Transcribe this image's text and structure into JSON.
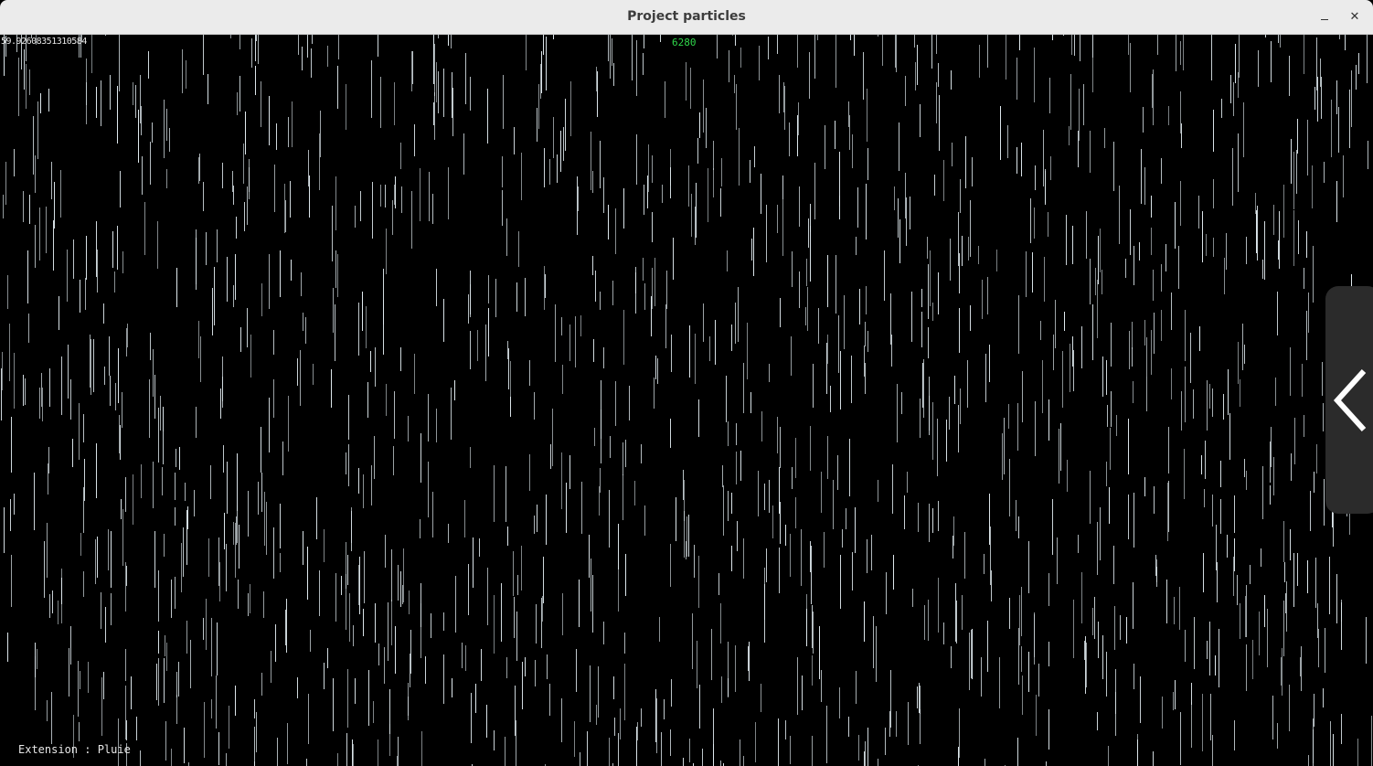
{
  "window": {
    "title": "Project particles",
    "minimize_label": "–",
    "close_label": "✕"
  },
  "overlay": {
    "fps_text": "59.92608351310584",
    "particle_count": "6280",
    "extension_text": "Extension : Pluie"
  },
  "side_panel": {
    "icon": "chevron-left-icon"
  },
  "colors": {
    "background": "#000000",
    "rain": "#dfe9ee",
    "count_text": "#2fd64a",
    "overlay_text": "#e8e8e8",
    "panel": "#2b2b2b"
  }
}
